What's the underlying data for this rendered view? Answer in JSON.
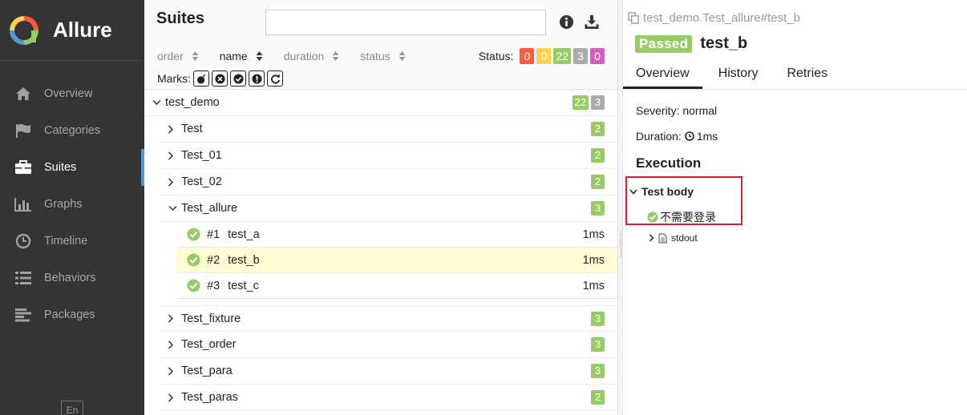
{
  "colors": {
    "sidebar_bg": "#343434",
    "accent": "#4e9ad6",
    "passed": "#97cc64",
    "failed": "#fd5a3e",
    "broken": "#ffd050",
    "skipped": "#aaaaaa",
    "unknown": "#d35ebe",
    "highlight": "#d62227"
  },
  "sidebar": {
    "brand": "Allure",
    "items": [
      {
        "label": "Overview",
        "icon": "home-icon"
      },
      {
        "label": "Categories",
        "icon": "flag-icon"
      },
      {
        "label": "Suites",
        "icon": "briefcase-icon"
      },
      {
        "label": "Graphs",
        "icon": "bar-chart-icon"
      },
      {
        "label": "Timeline",
        "icon": "clock-icon"
      },
      {
        "label": "Behaviors",
        "icon": "list-icon"
      },
      {
        "label": "Packages",
        "icon": "align-left-icon"
      }
    ],
    "active": "Suites",
    "lang": "En"
  },
  "suites": {
    "title": "Suites",
    "sort": {
      "order": "order",
      "name": "name",
      "duration": "duration",
      "status": "status"
    },
    "status_label": "Status:",
    "status_counts": {
      "failed": "0",
      "broken": "0",
      "passed": "22",
      "skipped": "3",
      "unknown": "0"
    },
    "marks_label": "Marks:",
    "tree": {
      "root": {
        "name": "test_demo",
        "passed": "22",
        "skipped": "3"
      },
      "groups_before": [
        {
          "name": "Test",
          "count": "2"
        },
        {
          "name": "Test_01",
          "count": "2"
        },
        {
          "name": "Test_02",
          "count": "2"
        }
      ],
      "expanded": {
        "name": "Test_allure",
        "count": "3"
      },
      "tests": [
        {
          "num": "#1",
          "name": "test_a",
          "duration": "1ms"
        },
        {
          "num": "#2",
          "name": "test_b",
          "duration": "1ms"
        },
        {
          "num": "#3",
          "name": "test_c",
          "duration": "1ms"
        }
      ],
      "groups_after": [
        {
          "name": "Test_fixture",
          "count": "3"
        },
        {
          "name": "Test_order",
          "count": "3"
        },
        {
          "name": "Test_para",
          "count": "3"
        },
        {
          "name": "Test_paras",
          "count": "2"
        }
      ]
    }
  },
  "detail": {
    "path": "test_demo.Test_allure#test_b",
    "status": "Passed",
    "title": "test_b",
    "tabs": [
      "Overview",
      "History",
      "Retries"
    ],
    "severity": "Severity: normal",
    "duration_label": "Duration:",
    "duration_value": "1ms",
    "execution_title": "Execution",
    "test_body": "Test body",
    "step": "不需要登录",
    "attachment": "stdout"
  }
}
